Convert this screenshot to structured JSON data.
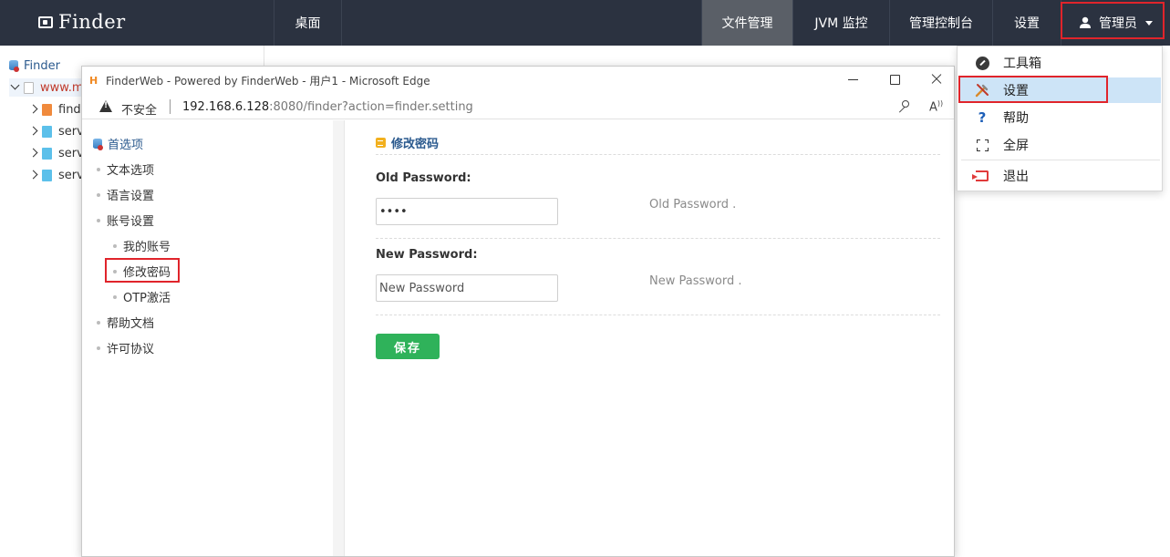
{
  "app": {
    "logo_text": "Finder"
  },
  "topnav": {
    "desktop": "桌面",
    "file_manager": "文件管理",
    "jvm_monitor": "JVM 监控",
    "admin_console": "管理控制台",
    "settings": "设置",
    "admin_user": "管理员"
  },
  "tree": {
    "root": "Finder",
    "host": "www.m",
    "items": [
      "finde",
      "serv",
      "serv",
      "serv"
    ]
  },
  "browser": {
    "title": "FinderWeb - Powered by FinderWeb - 用户1 - Microsoft Edge",
    "insecure_label": "不安全",
    "url_host": "192.168.6.128",
    "url_rest": ":8080/finder?action=finder.setting"
  },
  "settings_nav": {
    "home": "首选项",
    "items": {
      "text_options": "文本选项",
      "language": "语言设置",
      "account": "账号设置",
      "my_account": "我的账号",
      "change_password": "修改密码",
      "otp": "OTP激活",
      "help_docs": "帮助文档",
      "license": "许可协议"
    }
  },
  "form": {
    "section_title": "修改密码",
    "old_label": "Old Password:",
    "old_value": "••••",
    "old_hint": "Old Password .",
    "new_label": "New Password:",
    "new_placeholder": "New Password",
    "new_hint": "New Password .",
    "save": "保存"
  },
  "dropdown": {
    "toolbox": "工具箱",
    "settings": "设置",
    "help": "帮助",
    "fullscreen": "全屏",
    "logout": "退出"
  },
  "colors": {
    "topbar": "#2b3240",
    "active_nav": "#5a5f67",
    "highlight_box": "#e0242b",
    "save_button": "#2fb25a",
    "selected_menu": "#cde4f7"
  }
}
